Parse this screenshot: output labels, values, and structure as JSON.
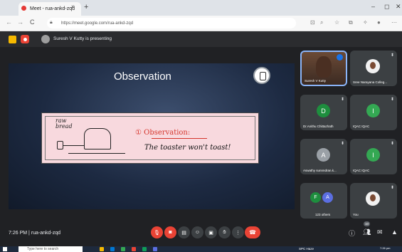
{
  "browser": {
    "tab_title": "Meet - rua-ankd-zqd",
    "new_tab": "+",
    "url": "https://meet.google.com/rua-ankd-zqd",
    "window_controls": [
      "–",
      "◻",
      "✕"
    ],
    "nav": [
      "←",
      "→",
      "C"
    ]
  },
  "meet": {
    "presenting_text": "Suresh V Kutty is presenting",
    "meeting_time": "7:26 PM",
    "meeting_code": "rua-ankd-zqd",
    "separator": "|",
    "people_count": "10"
  },
  "slide": {
    "title": "Observation",
    "card_label_raw": "raw",
    "card_label_bread": "bread",
    "observation_number": "①",
    "observation_heading": "Observation:",
    "observation_text": "The toaster won't toast!"
  },
  "tiles": [
    {
      "name": "Suresh V Kutty",
      "type": "speaker"
    },
    {
      "name": "Sree Narayana Colleg...",
      "type": "photo"
    },
    {
      "name": "Dr.Anithu Chittazhath",
      "initial": "D",
      "color": "#1e8e3e"
    },
    {
      "name": "IQAC IQAC",
      "initial": "I",
      "color": "#34a853"
    },
    {
      "name": "Aswathy sunnndran.k...",
      "initial": "A",
      "color": "#9aa0a6"
    },
    {
      "name": "IQAC IQAC",
      "initial": "I",
      "color": "#34a853"
    },
    {
      "name": "123 others",
      "initials": [
        "F",
        "A"
      ],
      "colors": [
        "#1e8e3e",
        "#5b6ee1"
      ]
    },
    {
      "name": "You",
      "type": "photo"
    }
  ],
  "taskbar": {
    "search_placeholder": "Type here to search",
    "weather": "SPC Haze",
    "clock_time": "7:26 pm",
    "lang": "ENG"
  }
}
